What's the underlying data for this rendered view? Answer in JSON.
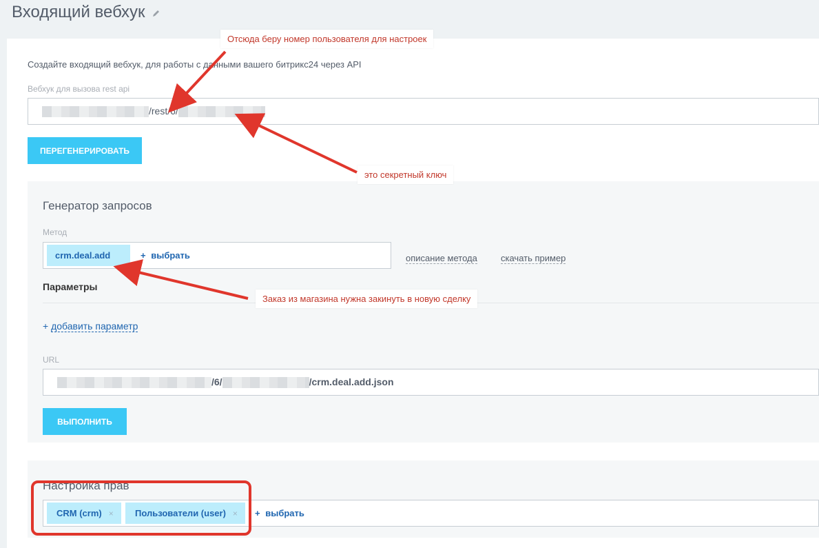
{
  "page": {
    "title": "Входящий вебхук"
  },
  "webhook": {
    "description": "Создайте входящий вебхук, для работы с данными вашего битрикс24 через API",
    "url_label": "Вебхук для вызова rest api",
    "url_visible_part": "/rest/6/",
    "regenerate_label": "ПЕРЕГЕНЕРИРОВАТЬ"
  },
  "generator": {
    "title": "Генератор запросов",
    "method_label": "Метод",
    "method_tag": "crm.deal.add",
    "select_label": "выбрать",
    "method_description_link": "описание метода",
    "download_example_link": "скачать пример",
    "params_title": "Параметры",
    "add_param_link": "добавить параметр",
    "url_label": "URL",
    "url_part_1": "/6/",
    "url_part_2": "/crm.deal.add.json",
    "execute_label": "ВЫПОЛНИТЬ"
  },
  "permissions": {
    "title": "Настройка прав",
    "tags": [
      {
        "label": "CRM (crm)"
      },
      {
        "label": "Пользователи (user)"
      }
    ],
    "select_label": "выбрать"
  },
  "annotations": {
    "user_number": "Отсюда беру  номер пользователя для настроек",
    "secret_key": "это секретный ключ",
    "order_note": "Заказ из магазина нужна закинуть в новую сделку"
  },
  "colors": {
    "accent": "#3bc8f5",
    "tag_bg": "#bcedfc",
    "link": "#2066b0",
    "annotation_red": "#e0362c"
  }
}
